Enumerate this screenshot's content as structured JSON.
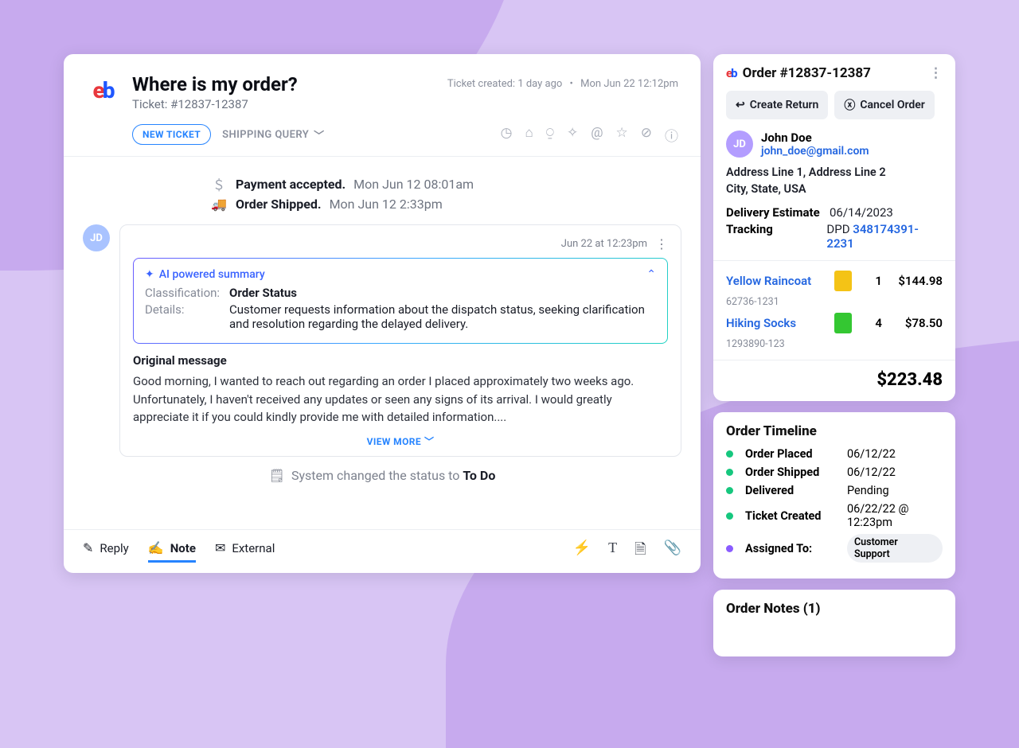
{
  "brand": {
    "e": "e",
    "b": "b"
  },
  "ticket": {
    "title": "Where is my order?",
    "sub_prefix": "Ticket: #",
    "number": "12837-12387",
    "created_label": "Ticket created: ",
    "created_rel": "1 day ago",
    "created_abs": "Mon Jun 22 12:12pm",
    "new_label": "NEW TICKET",
    "category": "SHIPPING QUERY"
  },
  "status": {
    "payment_label": "Payment accepted.",
    "payment_time": "Mon Jun 12 08:01am",
    "shipped_label": "Order Shipped.",
    "shipped_time": "Mon Jun 12 2:33pm"
  },
  "message": {
    "avatar": "JD",
    "timestamp": "Jun 22 at 12:23pm",
    "ai_title": "AI powered summary",
    "class_key": "Classification:",
    "class_val": "Order Status",
    "details_key": "Details:",
    "details_val": "Customer requests information about the dispatch status, seeking clarification and resolution regarding the delayed delivery.",
    "orig_title": "Original message",
    "orig_body": "Good morning, I wanted to reach out regarding an order I placed approximately two weeks ago. Unfortunately, I haven't received any updates or seen any signs of its arrival. I would greatly appreciate it if you could kindly provide me with detailed information....",
    "view_more": "VIEW MORE"
  },
  "system": {
    "prefix": "System changed the status to ",
    "status": "To Do"
  },
  "composer": {
    "reply": "Reply",
    "note": "Note",
    "external": "External"
  },
  "order": {
    "title_prefix": "Order #",
    "number": "12837-12387",
    "create_return": "Create Return",
    "cancel_order": "Cancel Order",
    "customer_avatar": "JD",
    "customer_name": "John Doe",
    "customer_email": "john_doe@gmail.com",
    "address_line1": "Address Line 1, Address Line 2",
    "address_line2": "City, State, USA",
    "delivery_key": "Delivery Estimate",
    "delivery_val": "06/14/2023",
    "tracking_key": "Tracking",
    "tracking_carrier": "DPD ",
    "tracking_no": "348174391-2231",
    "items": [
      {
        "name": "Yellow Raincoat",
        "sku": "62736-1231",
        "qty": "1",
        "price": "$144.98",
        "color": "#f4c316"
      },
      {
        "name": "Hiking Socks",
        "sku": "1293890-123",
        "qty": "4",
        "price": "$78.50",
        "color": "#34c732"
      }
    ],
    "total": "$223.48"
  },
  "timeline": {
    "title": "Order Timeline",
    "rows": [
      {
        "k": "Order Placed",
        "v": "06/12/22"
      },
      {
        "k": "Order Shipped",
        "v": "06/12/22"
      },
      {
        "k": "Delivered",
        "v": "Pending"
      },
      {
        "k": "Ticket Created",
        "v": "06/22/22 @ 12:23pm"
      }
    ],
    "assigned_k": "Assigned To:",
    "assigned_v": "Customer Support"
  },
  "notes": {
    "title": "Order Notes (1)"
  }
}
